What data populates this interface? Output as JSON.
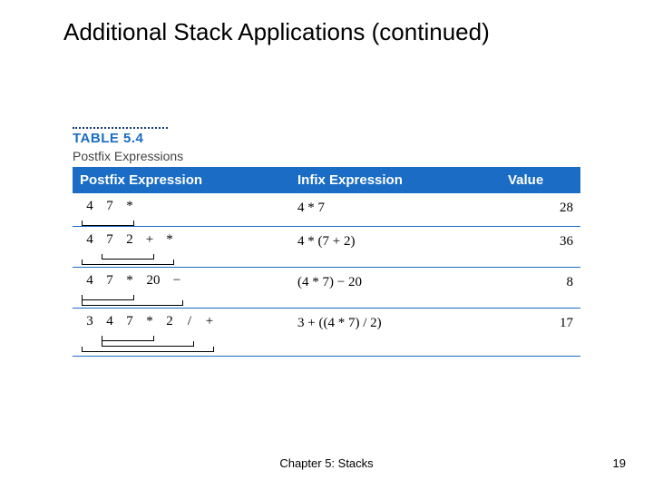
{
  "title": "Additional Stack Applications (continued)",
  "table": {
    "label": "TABLE 5.4",
    "caption": "Postfix Expressions",
    "headers": {
      "col1": "Postfix Expression",
      "col2": "Infix Expression",
      "col3": "Value"
    },
    "rows": [
      {
        "postfix": [
          "4",
          "7",
          "*"
        ],
        "infix": "4 * 7",
        "value": "28"
      },
      {
        "postfix": [
          "4",
          "7",
          "2",
          "+",
          "*"
        ],
        "infix": "4 * (7 + 2)",
        "value": "36"
      },
      {
        "postfix": [
          "4",
          "7",
          "*",
          "20",
          "−"
        ],
        "infix": "(4 * 7) − 20",
        "value": "8"
      },
      {
        "postfix": [
          "3",
          "4",
          "7",
          "*",
          "2",
          "/",
          "+"
        ],
        "infix": "3 + ((4 * 7) / 2)",
        "value": "17"
      }
    ]
  },
  "footer": {
    "center": "Chapter 5: Stacks",
    "page": "19"
  }
}
